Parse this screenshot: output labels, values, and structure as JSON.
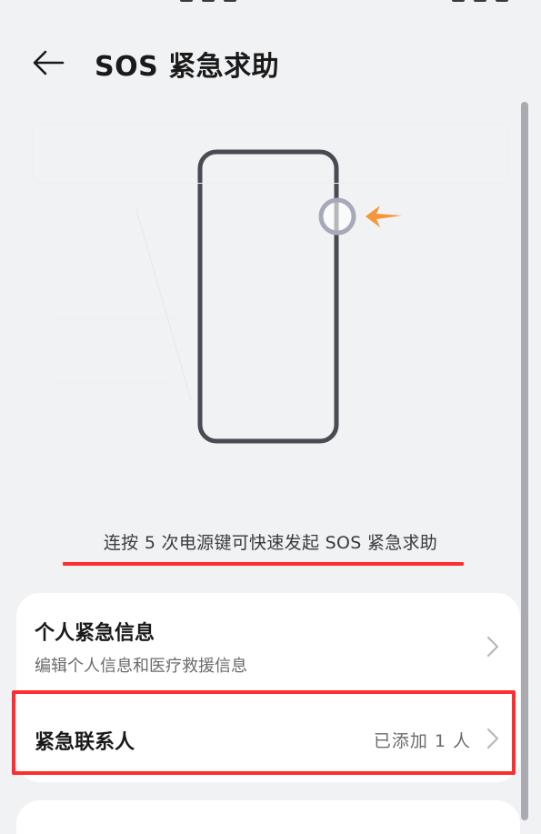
{
  "header": {
    "title": "SOS 紧急求助",
    "back_icon": "arrow-left-icon"
  },
  "illustration": {
    "subject": "phone-power-button-icon",
    "arrow_color": "#f5963a",
    "button_ring_color": "#a6aab8",
    "phone_outline_color": "#4a4b52"
  },
  "caption": "连按 5 次电源键可快速发起 SOS 紧急求助",
  "settings": {
    "personal_info": {
      "title": "个人紧急信息",
      "subtitle": "编辑个人信息和医疗救援信息"
    },
    "emergency_contacts": {
      "title": "紧急联系人",
      "value": "已添加 1 人"
    }
  },
  "colors": {
    "highlight": "#ff2d2d",
    "background": "#f1f2f4",
    "card": "#ffffff"
  }
}
